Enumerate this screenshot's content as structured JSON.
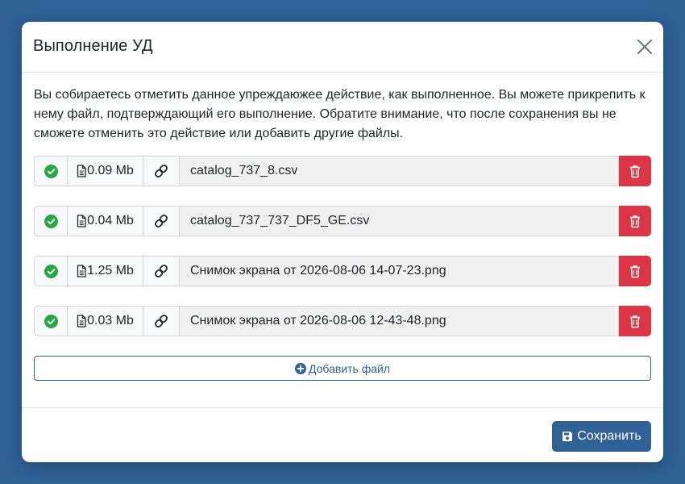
{
  "modal": {
    "title": "Выполнение УД",
    "description": "Вы собираетесь отметить данное упреждаюжее действие, как выполненное. Вы можете прикрепить к нему файл, подтверждающий его выполнение. Обратите внимание, что после сохранения вы не сможете отменить это действие или добавить другие файлы."
  },
  "files": [
    {
      "size": "0.09 Mb",
      "name": "catalog_737_8.csv"
    },
    {
      "size": "0.04 Mb",
      "name": "catalog_737_737_DF5_GE.csv"
    },
    {
      "size": "1.25 Mb",
      "name": "Снимок экрана от 2026-08-06 14-07-23.png"
    },
    {
      "size": "0.03 Mb",
      "name": "Снимок экрана от 2026-08-06 12-43-48.png"
    }
  ],
  "actions": {
    "add_file_label": "Добавить файл",
    "save_label": "Сохранить"
  },
  "colors": {
    "background": "#2f6096",
    "primary": "#2f6096",
    "success": "#28a745",
    "danger": "#dc3545"
  },
  "icons": {
    "close": "close-icon",
    "status": "check-circle-icon",
    "file": "file-icon",
    "link": "link-icon",
    "delete": "trash-icon",
    "add": "plus-circle-icon",
    "save": "save-icon"
  }
}
